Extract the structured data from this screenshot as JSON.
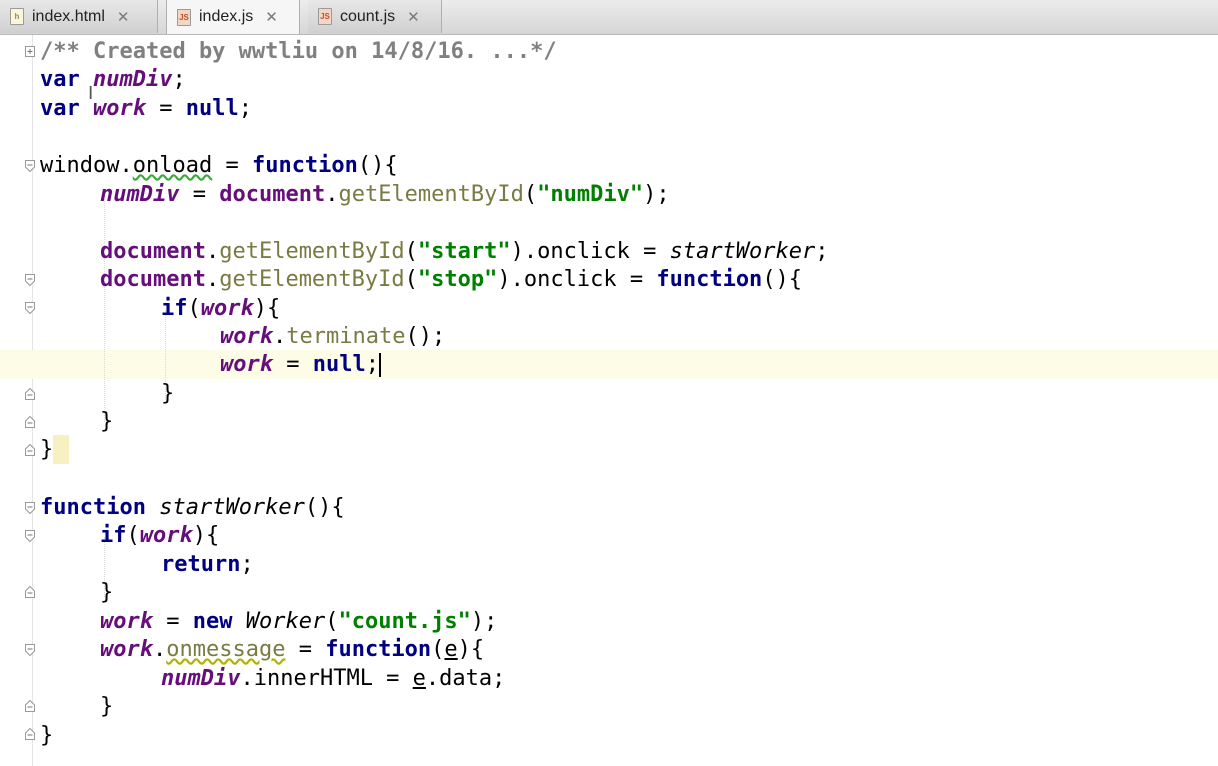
{
  "tabs": [
    {
      "label": "index.html",
      "icon": "html-file-icon",
      "close": "✕",
      "active": false
    },
    {
      "label": "index.js",
      "icon": "js-file-icon",
      "close": "✕",
      "active": true
    },
    {
      "label": "count.js",
      "icon": "js-file-icon",
      "close": "✕",
      "active": false
    }
  ],
  "file_icon_text": {
    "html": "h",
    "js": "JS"
  },
  "code": {
    "l1": {
      "t1": "/** Created by wwtliu on 14/8/16. ...*/"
    },
    "l2": {
      "t1": "var",
      "t2": " ",
      "t3": "numDiv",
      "t4": ";"
    },
    "l3": {
      "t1": "var",
      "t2": " ",
      "t3": "work",
      "t4": " = ",
      "t5": "null",
      "t6": ";"
    },
    "l5": {
      "t1": "window.",
      "t2": "onload",
      "t3": " = ",
      "t4": "function",
      "t5": "(){"
    },
    "l6": {
      "t1": "numDiv",
      "t2": " = ",
      "t3": "document",
      "t4": ".",
      "t5": "getElementById",
      "t6": "(",
      "t7": "\"numDiv\"",
      "t8": ");"
    },
    "l8": {
      "t1": "document",
      "t2": ".",
      "t3": "getElementById",
      "t4": "(",
      "t5": "\"start\"",
      "t6": ").onclick = ",
      "t7": "startWorker",
      "t8": ";"
    },
    "l9": {
      "t1": "document",
      "t2": ".",
      "t3": "getElementById",
      "t4": "(",
      "t5": "\"stop\"",
      "t6": ").onclick = ",
      "t7": "function",
      "t8": "(){"
    },
    "l10": {
      "t1": "if",
      "t2": "(",
      "t3": "work",
      "t4": "){"
    },
    "l11": {
      "t1": "work",
      "t2": ".",
      "t3": "terminate",
      "t4": "();"
    },
    "l12": {
      "t1": "work",
      "t2": " = ",
      "t3": "null",
      "t4": ";"
    },
    "l13": {
      "t1": "}"
    },
    "l14": {
      "t1": "}"
    },
    "l15": {
      "t1": "}"
    },
    "l17": {
      "t1": "function",
      "t2": " ",
      "t3": "startWorker",
      "t4": "(){"
    },
    "l18": {
      "t1": "if",
      "t2": "(",
      "t3": "work",
      "t4": "){"
    },
    "l19": {
      "t1": "return",
      "t2": ";"
    },
    "l20": {
      "t1": "}"
    },
    "l21": {
      "t1": "work",
      "t2": " = ",
      "t3": "new",
      "t4": " ",
      "t5": "Worker",
      "t6": "(",
      "t7": "\"count.js\"",
      "t8": ");"
    },
    "l22": {
      "t1": "work",
      "t2": ".",
      "t3": "onmessage",
      "t4": " = ",
      "t5": "function",
      "t6": "(",
      "t7": "e",
      "t8": "){"
    },
    "l23": {
      "t1": "numDiv",
      "t2": ".innerHTML = ",
      "t3": "e",
      "t4": ".data;"
    },
    "l24": {
      "t1": "}"
    },
    "l25": {
      "t1": "}"
    }
  },
  "colors": {
    "keyword": "#000080",
    "string": "#008000",
    "comment": "#808080",
    "variable": "#660e7a",
    "method": "#7a7a43",
    "caret_line": "#fdfce6"
  }
}
